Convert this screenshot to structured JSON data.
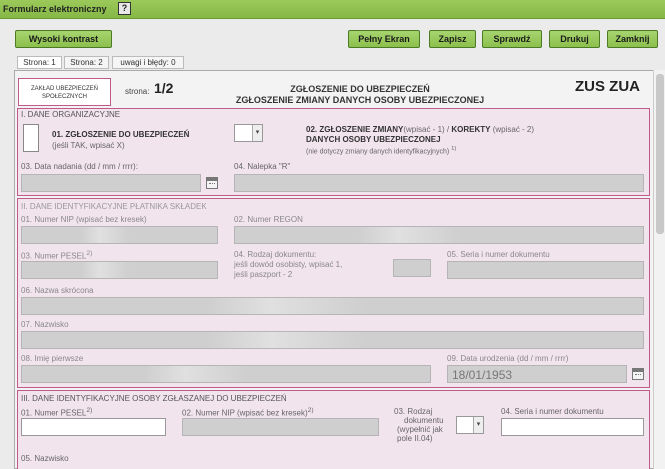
{
  "window": {
    "title": "Formularz elektroniczny"
  },
  "toolbar": {
    "high_contrast": "Wysoki kontrast",
    "fullscreen": "Pełny Ekran",
    "save": "Zapisz",
    "check": "Sprawdź",
    "print": "Drukuj",
    "close": "Zamknij"
  },
  "tabs": [
    "Strona: 1",
    "Strona: 2",
    "uwagi i błędy: 0"
  ],
  "form": {
    "zus_line1": "ZAKŁAD UBEZPIECZEŃ",
    "zus_line2": "SPOŁECZNYCH",
    "page_label": "strona:",
    "page_value": "1/2",
    "title1": "ZGŁOSZENIE DO UBEZPIECZEŃ",
    "title2": "ZGŁOSZENIE ZMIANY DANYCH OSOBY UBEZPIECZONEJ",
    "code": "ZUS ZUA"
  },
  "section1": {
    "title": "I. DANE ORGANIZACYJNE",
    "f01": "01. ZGŁOSZENIE DO UBEZPIECZEŃ",
    "f01_hint": "(jeśli TAK, wpisać X)",
    "f02_a": "02. ZGŁOSZENIE ZMIANY",
    "f02_b": "(wpisać - 1) / ",
    "f02_c": "KOREKTY",
    "f02_d": " (wpisać - 2)",
    "f02_line2": "DANYCH OSOBY UBEZPIECZONEJ",
    "f02_hint": "(nie dotyczy zmiany danych identyfikacyjnych)",
    "f02_sup": "1)",
    "f03": "03. Data nadania (dd / mm / rrrr):",
    "f04": "04. Nalepka \"R\""
  },
  "section2": {
    "title": "II. DANE IDENTYFIKACYJNE PŁATNIKA SKŁADEK",
    "f01": "01. Numer NIP (wpisać bez kresek)",
    "f02": "02. Numer REGON",
    "f03": "03. Numer PESEL",
    "f03_sup": "2)",
    "f04": "04. Rodzaj dokumentu:",
    "f04_line2": "jeśli dowód osobisty, wpisać 1,",
    "f04_line3": "jeśli paszport - 2",
    "f05": "05. Seria i numer dokumentu",
    "f06": "06. Nazwa skrócona",
    "f07": "07. Nazwisko",
    "f08": "08. Imię pierwsze",
    "f09": "09. Data urodzenia (dd / mm / rrrr)",
    "f09_value": "18/01/1953"
  },
  "section3": {
    "title": "III. DANE IDENTYFIKACYJNE OSOBY ZGŁASZANEJ DO UBEZPIECZEŃ",
    "f01": "01. Numer PESEL",
    "f01_sup": "2)",
    "f02": "02. Numer NIP (wpisać bez kresek)",
    "f02_sup": "2)",
    "f03_l1": "03. Rodzaj",
    "f03_l2": "dokumentu",
    "f03_l3": "(wypełnić jak",
    "f03_l4": "pole II.04)",
    "f04": "04. Seria i numer dokumentu",
    "f05": "05. Nazwisko"
  }
}
